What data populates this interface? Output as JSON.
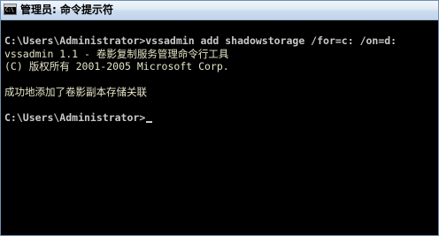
{
  "window": {
    "title": "管理员: 命令提示符",
    "icon": "cmd-console-icon",
    "icon_glyph": "C:\\"
  },
  "console": {
    "command": "C:\\Users\\Administrator>vssadmin add shadowstorage /for=c: /on=d:",
    "version_line": "vssadmin 1.1 - 卷影复制服务管理命令行工具",
    "copyright_line": "(C) 版权所有 2001-2005 Microsoft Corp.",
    "result_line": "成功地添加了卷影副本存储关联",
    "prompt": "C:\\Users\\Administrator>"
  },
  "colors": {
    "console_background": "#000000",
    "console_text": "#c8c8c8",
    "titlebar_top": "#f2f6fb",
    "titlebar_bottom": "#c1d4ea"
  }
}
